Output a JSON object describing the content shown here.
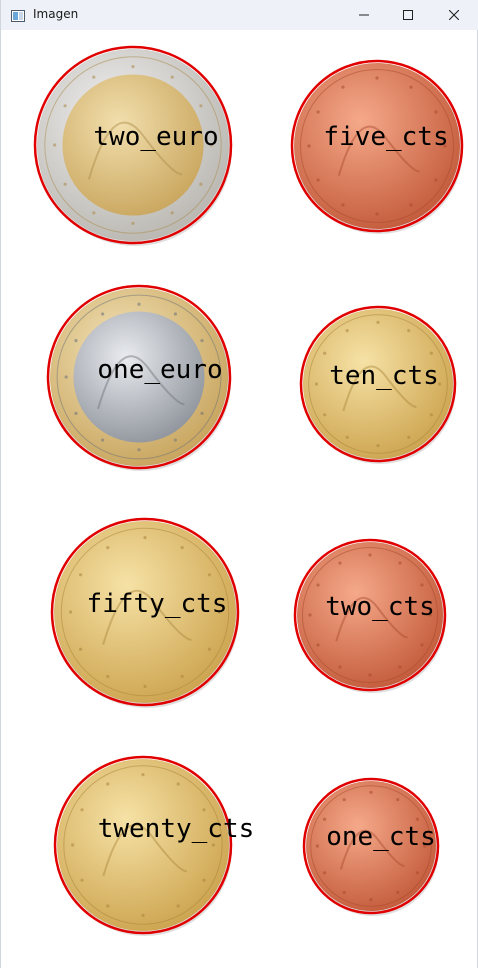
{
  "window": {
    "title": "Imagen",
    "icons": {
      "app": "image-window-icon",
      "minimize": "minimize-icon",
      "maximize": "maximize-icon",
      "close": "close-icon"
    }
  },
  "detection": {
    "circle_color": "#e00000",
    "coins": [
      {
        "label": "two_euro",
        "type": "bimetal-gold-center"
      },
      {
        "label": "five_cts",
        "type": "copper"
      },
      {
        "label": "one_euro",
        "type": "bimetal-silver-center"
      },
      {
        "label": "ten_cts",
        "type": "gold"
      },
      {
        "label": "fifty_cts",
        "type": "gold"
      },
      {
        "label": "two_cts",
        "type": "copper"
      },
      {
        "label": "twenty_cts",
        "type": "gold"
      },
      {
        "label": "one_cts",
        "type": "copper"
      }
    ]
  }
}
